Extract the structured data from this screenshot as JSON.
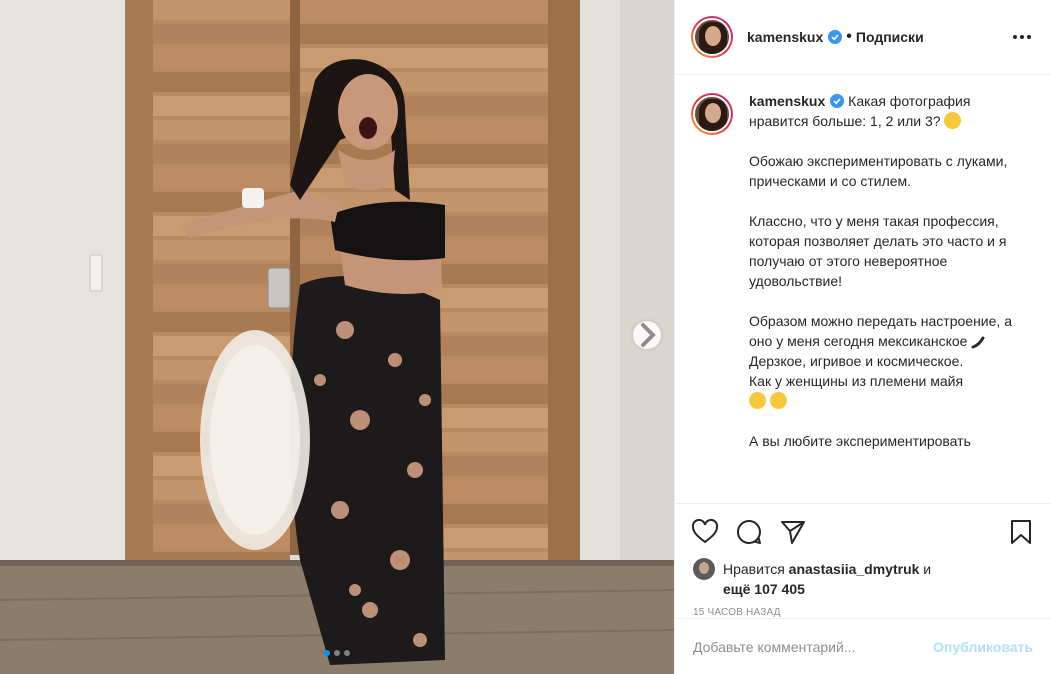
{
  "post": {
    "username": "kamenskux",
    "follow_separator": "•",
    "follow_label": "Подписки",
    "caption_intro": "Какая фотография нравится больше: 1, 2 или 3?",
    "caption_paragraphs": [
      "Обожаю экспериментировать с луками, прическами и со стилем.",
      "Классно, что у меня такая профессия, которая позволяет делать это часто и я получаю от этого невероятное удовольствие!",
      "Образом можно передать настроение, а оно у меня сегодня мексиканское"
    ],
    "caption_line_2": "Дерзкое, игривое и космическое.",
    "caption_line_3": "Как у женщины из племени майя",
    "caption_cut": "А вы любите экспериментировать",
    "likes_prefix": "Нравится",
    "likes_user": "anastasiia_dmytruk",
    "likes_and": "и",
    "likes_more_prefix": "ещё",
    "likes_count": "107 405",
    "timestamp": "15 часов назад",
    "comment_placeholder": "Добавьте комментарий...",
    "publish_label": "Опубликовать"
  },
  "carousel": {
    "total": 3,
    "current": 1
  },
  "colors": {
    "verified": "#3897f0",
    "active_dot": "#0095f6",
    "publish_disabled": "#b2dffc",
    "muted_text": "#8e8e8e"
  },
  "icons": {
    "verified": "verified-badge-icon",
    "more": "more-options-icon",
    "like": "heart-icon",
    "comment": "comment-icon",
    "share": "send-icon",
    "save": "bookmark-icon",
    "next": "chevron-right-icon",
    "emoji_thinking": "thinking-face-emoji",
    "emoji_pepper": "chili-pepper-emoji",
    "emoji_wink": "winking-face-emoji",
    "emoji_laugh": "tears-of-joy-emoji"
  }
}
